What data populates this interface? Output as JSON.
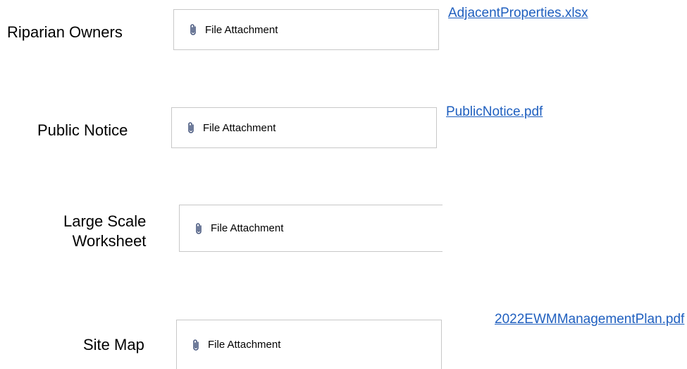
{
  "rows": [
    {
      "label": "Riparian Owners",
      "attachment_label": "File Attachment",
      "link": "AdjacentProperties.xlsx"
    },
    {
      "label": "Public Notice",
      "attachment_label": "File Attachment",
      "link": "PublicNotice.pdf"
    },
    {
      "label_line1": "Large Scale",
      "label_line2": "Worksheet",
      "attachment_label": "File Attachment"
    },
    {
      "label": "Site Map",
      "attachment_label": "File Attachment",
      "link": "2022EWMManagementPlan.pdf"
    }
  ],
  "colors": {
    "link": "#1f5fbf",
    "border": "#c8c8c8",
    "icon": "#4a5a80"
  },
  "icons": {
    "attachment": "paperclip-icon"
  }
}
